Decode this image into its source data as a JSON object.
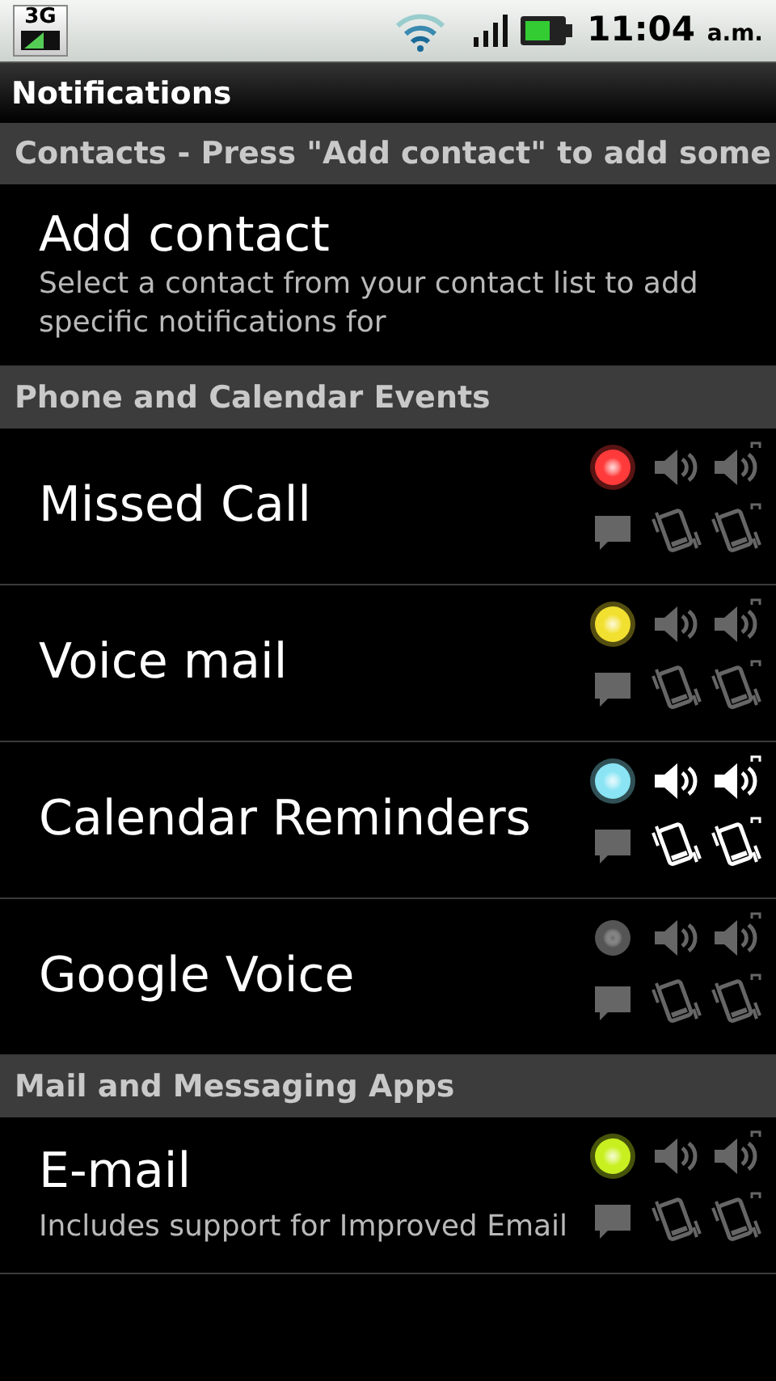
{
  "status_bar": {
    "network": "3G",
    "time": "11:04",
    "time_suffix": "a.m."
  },
  "title": "Notifications",
  "sections": [
    {
      "header": "Contacts - Press \"Add contact\" to add some",
      "items": [
        {
          "kind": "action",
          "title": "Add contact",
          "subtitle": "Select a contact from your contact list to add specific notifications for"
        }
      ]
    },
    {
      "header": "Phone and Calendar Events",
      "items": [
        {
          "kind": "event",
          "title": "Missed Call",
          "led": {
            "on": true,
            "color": "#ff3a3a"
          },
          "sound": false,
          "repeat_sound": false,
          "vibrate": false,
          "repeat_vibrate": false
        },
        {
          "kind": "event",
          "title": "Voice mail",
          "led": {
            "on": true,
            "color": "#f2e030"
          },
          "sound": false,
          "repeat_sound": false,
          "vibrate": false,
          "repeat_vibrate": false
        },
        {
          "kind": "event",
          "title": "Calendar Reminders",
          "led": {
            "on": true,
            "color": "#8ae4f4"
          },
          "sound": true,
          "repeat_sound": true,
          "vibrate": true,
          "repeat_vibrate": true
        },
        {
          "kind": "event",
          "title": "Google Voice",
          "led": {
            "on": false,
            "color": "#555555"
          },
          "sound": false,
          "repeat_sound": false,
          "vibrate": false,
          "repeat_vibrate": false
        }
      ]
    },
    {
      "header": "Mail and Messaging Apps",
      "items": [
        {
          "kind": "event",
          "title": "E-mail",
          "subtitle": "Includes support for Improved Email",
          "led": {
            "on": true,
            "color": "#c8f020"
          },
          "sound": false,
          "repeat_sound": false,
          "vibrate": false,
          "repeat_vibrate": false
        }
      ]
    }
  ]
}
